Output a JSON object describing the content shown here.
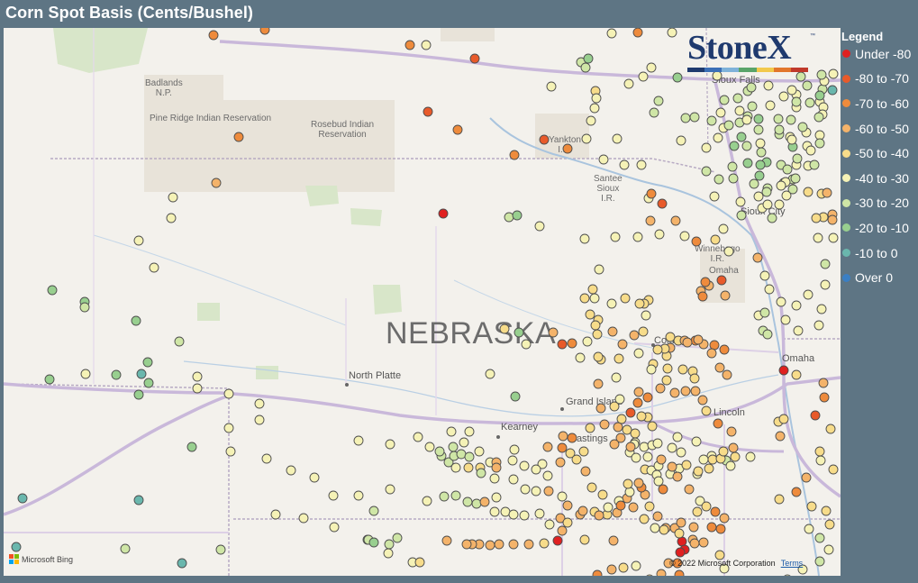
{
  "title": "Corn Spot Basis (Cents/Bushel)",
  "logo": {
    "text": "StoneX",
    "tm": "™",
    "bar_colors": [
      "#1f3a6e",
      "#3b6fb6",
      "#7fb2d9",
      "#5aa469",
      "#f2c94c",
      "#e2762b",
      "#c0392b"
    ]
  },
  "state_label": "NEBRASKA",
  "places": {
    "badlands": "Badlands\nN.P.",
    "pine_ridge": "Pine Ridge Indian Reservation",
    "rosebud": "Rosebud Indian\nReservation",
    "yankton": "Yankton\nI.R.",
    "santee": "Santee\nSioux\nI.R.",
    "winnebago": "Winnebago\nI.R.",
    "omaha_ir": "Omaha"
  },
  "cities": {
    "north_platte": "North Platte",
    "columbus": "Columbus",
    "grand_island": "Grand Island",
    "kearney": "Kearney",
    "hastings": "Hastings",
    "lincoln": "Lincoln",
    "omaha": "Omaha",
    "sioux_city": "Sioux City",
    "sioux_falls": "Sioux Falls"
  },
  "bing": "Microsoft Bing",
  "copyright": "© 2022 Microsoft Corporation",
  "terms": "Terms",
  "legend": {
    "title": "Legend",
    "items": [
      {
        "label": "Under -80",
        "color": "#e02020"
      },
      {
        "label": "-80 to -70",
        "color": "#e85a2a"
      },
      {
        "label": "-70 to -60",
        "color": "#ee8b3c"
      },
      {
        "label": "-60 to -50",
        "color": "#f4b36a"
      },
      {
        "label": "-50 to -40",
        "color": "#f7dc8a"
      },
      {
        "label": "-40 to -30",
        "color": "#f5f2b6"
      },
      {
        "label": "-30 to -20",
        "color": "#cfe6a6"
      },
      {
        "label": "-20 to -10",
        "color": "#98cf8f"
      },
      {
        "label": "-10 to 0",
        "color": "#6ab7ad"
      },
      {
        "label": "Over 0",
        "color": "#3a7fc4"
      }
    ]
  }
}
